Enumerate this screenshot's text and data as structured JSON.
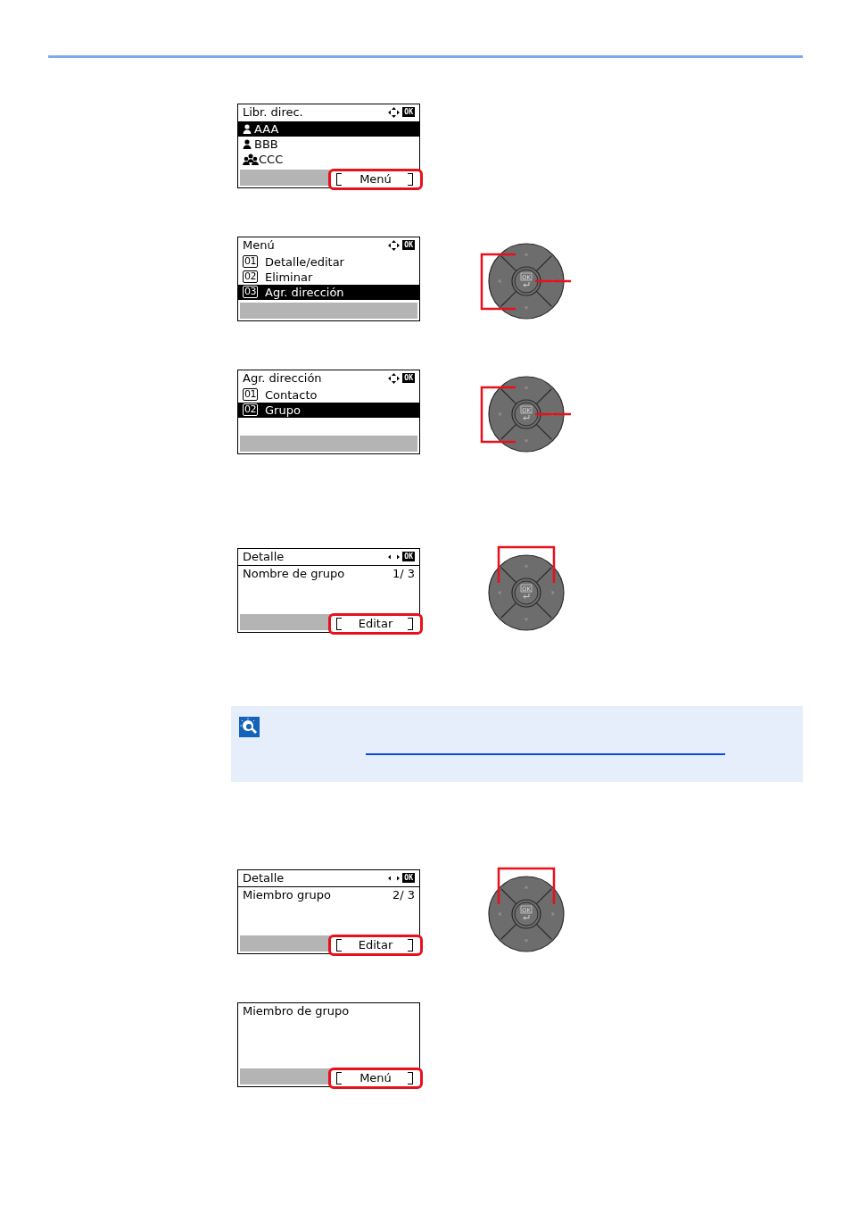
{
  "sections": [
    {
      "kind": "screen",
      "header": {
        "title": "Libr. direc.",
        "kind": "four-way",
        "ok_label": "OK"
      },
      "header_rule": false,
      "items": [
        {
          "kind": "person",
          "label": "AAA",
          "selected": true
        },
        {
          "kind": "person",
          "label": "BBB",
          "selected": false
        },
        {
          "kind": "group",
          "label": "CCC",
          "selected": false
        }
      ],
      "softkey": {
        "label": "Menú",
        "highlighted": true
      }
    },
    {
      "kind": "screen",
      "header": {
        "title": "Menú",
        "kind": "four-way",
        "ok_label": "OK"
      },
      "header_rule": false,
      "items": [
        {
          "number": "01",
          "label": "Detalle/editar",
          "selected": false
        },
        {
          "number": "02",
          "label": "Eliminar",
          "selected": false
        },
        {
          "number": "03",
          "label": "Agr. dirección",
          "selected": true
        }
      ],
      "keypad": {
        "kind": "up-down-ok",
        "ok_label": "OK"
      }
    },
    {
      "kind": "screen",
      "header": {
        "title": "Agr. dirección",
        "kind": "four-way",
        "ok_label": "OK"
      },
      "header_rule": false,
      "items": [
        {
          "number": "01",
          "label": "Contacto",
          "selected": false
        },
        {
          "number": "02",
          "label": "Grupo",
          "selected": true
        }
      ],
      "keypad": {
        "kind": "up-down-ok",
        "ok_label": "OK"
      }
    },
    {
      "kind": "screen",
      "header": {
        "title": "Detalle",
        "kind": "left-right",
        "ok_label": "OK"
      },
      "header_rule": true,
      "items": [
        {
          "label": "Nombre de grupo",
          "value": "1/ 3",
          "selected": false
        }
      ],
      "softkey": {
        "label": "Editar",
        "highlighted": true
      },
      "keypad": {
        "kind": "left-right",
        "ok_label": "OK"
      }
    },
    {
      "kind": "note"
    },
    {
      "kind": "screen",
      "header": {
        "title": "Detalle",
        "kind": "left-right",
        "ok_label": "OK"
      },
      "header_rule": true,
      "items": [
        {
          "label": "Miembro grupo",
          "value": "2/ 3",
          "selected": false
        }
      ],
      "softkey": {
        "label": "Editar",
        "highlighted": true
      },
      "keypad": {
        "kind": "left-right",
        "ok_label": "OK"
      }
    },
    {
      "kind": "screen",
      "header": {
        "title": "Miembro de grupo",
        "kind": "plain"
      },
      "softkey": {
        "label": "Menú",
        "highlighted": true
      }
    }
  ]
}
